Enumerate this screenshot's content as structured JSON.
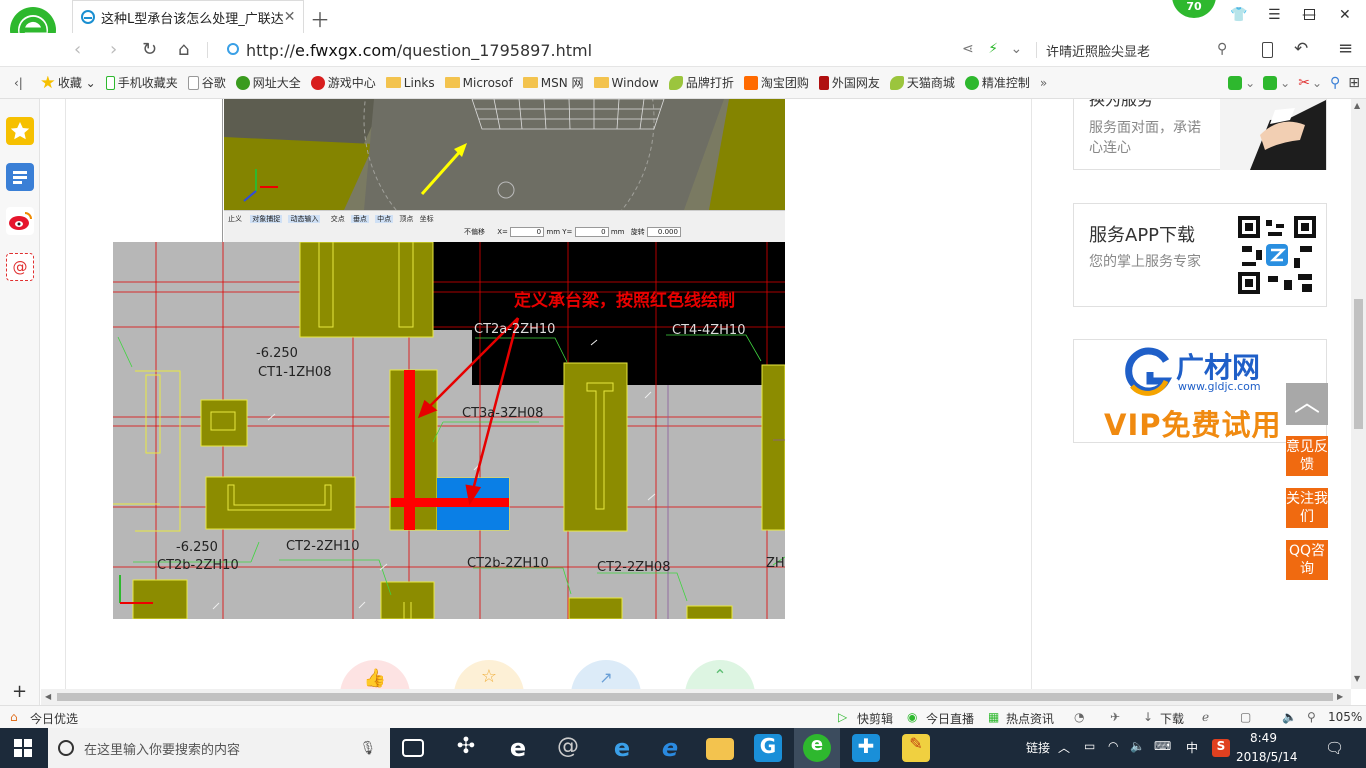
{
  "browser": {
    "tab_title": "这种L型承台该怎么处理_广联达",
    "badge": "70",
    "url_scheme": "http://",
    "url_host": "e.fwxgx.com",
    "url_path": "/question_1795897.html",
    "search_text": "许晴近照脸尖显老"
  },
  "bookmarks": [
    {
      "label": "收藏",
      "icon": "star-icon"
    },
    {
      "label": "手机收藏夹",
      "icon": "phone-icon"
    },
    {
      "label": "谷歌",
      "icon": "page-icon"
    },
    {
      "label": "网址大全",
      "icon": "nav-site-icon"
    },
    {
      "label": "游戏中心",
      "icon": "game-icon"
    },
    {
      "label": "Links",
      "icon": "folder-icon"
    },
    {
      "label": "Microsof",
      "icon": "folder-icon"
    },
    {
      "label": "MSN 网",
      "icon": "folder-icon"
    },
    {
      "label": "Window",
      "icon": "folder-icon"
    },
    {
      "label": "品牌打折",
      "icon": "leaf-icon"
    },
    {
      "label": "淘宝团购",
      "icon": "taobao-icon"
    },
    {
      "label": "外国网友",
      "icon": "bookmark-icon"
    },
    {
      "label": "天猫商城",
      "icon": "leaf-icon"
    },
    {
      "label": "精准控制",
      "icon": "wechat-icon"
    }
  ],
  "cad": {
    "annotation": "定义承台梁，按照红色线绘制",
    "labels": [
      {
        "text": "-6.250"
      },
      {
        "text": "CT1-1ZH08"
      },
      {
        "text": "CT2a-2ZH10"
      },
      {
        "text": "CT4-4ZH10"
      },
      {
        "text": "CT3a-3ZH08"
      },
      {
        "text": "-6.250"
      },
      {
        "text": "CT2-2ZH10"
      },
      {
        "text": "CT2b-2ZH10"
      },
      {
        "text": "CT2b-2ZH10"
      },
      {
        "text": "CT2-2ZH08"
      },
      {
        "text": "ZH"
      }
    ],
    "toolbar_items": [
      "止义",
      "对象捕捉",
      "动态输入",
      "交点",
      "垂点",
      "中点",
      "顶点",
      "坐标"
    ],
    "toolbar_mode": "不偏移",
    "x_label": "X=",
    "x_value": "0",
    "y_label": "mm Y=",
    "y_value": "0",
    "unit_end": "mm",
    "rotate_label": "旋转",
    "rotate_value": "0.000"
  },
  "right": {
    "card1_title": "换为服务",
    "card1_desc": "服务面对面，承诺心连心",
    "card2_title": "服务APP下载",
    "card2_desc": "您的掌上服务专家",
    "ad_brand": "广材网",
    "ad_url": "www.gldjc.com",
    "ad_vip": "VIP免费试用",
    "btn_feedback": "意见反馈",
    "btn_follow": "关注我们",
    "btn_qq": "QQ咨询"
  },
  "status": {
    "today": "今日优选",
    "kuaijian": "快剪辑",
    "live": "今日直播",
    "news": "热点资讯",
    "download": "下载",
    "zoom": "105%"
  },
  "taskbar": {
    "search_placeholder": "在这里输入你要搜索的内容",
    "tray_link": "链接",
    "ime": "中",
    "time": "8:49",
    "date": "2018/5/14"
  },
  "colors": {
    "cad_yellow": "#8c8c00",
    "cad_red": "#ff0000",
    "cad_blue": "#0a7fe6",
    "accent_orange": "#f06a10",
    "annotation_red": "#e60000"
  }
}
